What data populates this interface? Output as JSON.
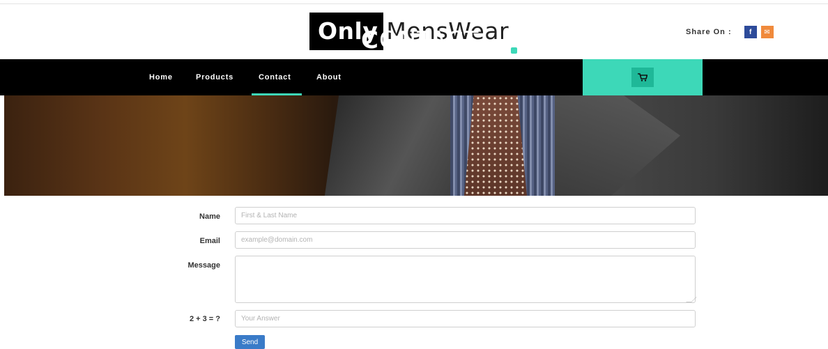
{
  "header": {
    "logo_bold": "Only",
    "logo_rest": "MensWear",
    "share_label": "Share On :",
    "share_facebook_icon": "f",
    "share_email_icon": "✉"
  },
  "nav": {
    "items": [
      {
        "label": "Home"
      },
      {
        "label": "Products"
      },
      {
        "label": "Contact",
        "active": true
      },
      {
        "label": "About"
      }
    ],
    "cart_icon": "cart-icon",
    "accent_color": "#3dd8b8"
  },
  "banner": {
    "title_first_letter": "C",
    "title_rest": "ONTACT"
  },
  "form": {
    "name_label": "Name",
    "name_placeholder": "First & Last Name",
    "email_label": "Email",
    "email_placeholder": "example@domain.com",
    "message_label": "Message",
    "message_value": "",
    "captcha_label": "2 + 3 = ?",
    "captcha_placeholder": "Your Answer",
    "send_label": "Send"
  }
}
